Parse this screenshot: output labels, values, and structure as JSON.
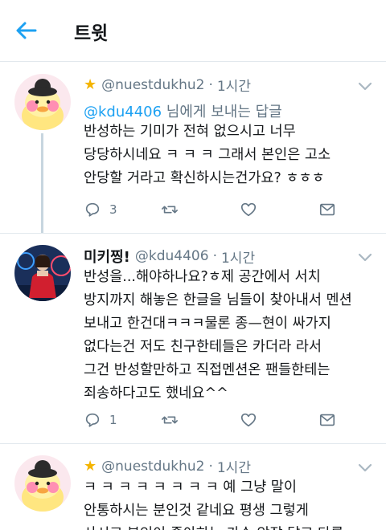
{
  "header": {
    "title": "트윗"
  },
  "tweets": [
    {
      "star": "★",
      "display_name": "",
      "handle": "@nuestdukhu2",
      "sep": "·",
      "time": "1시간",
      "reply_mention": "@kdu4406",
      "reply_suffix": " 님에게 보내는 답글",
      "lines": [
        "반성하는 기미가 전혀 없으시고 너무",
        "당당하시네요 ㅋ ㅋ ㅋ 그래서 본인은 고소",
        "안당할 거라고 확신하시는건가요? ㅎㅎㅎ"
      ],
      "reply_count": "3",
      "retweet_count": "",
      "like_count": ""
    },
    {
      "star": "",
      "display_name": "미키찡!",
      "handle": "@kdu4406",
      "sep": "·",
      "time": "1시간",
      "lines": [
        "반성을...해야하나요?ㅎ제 공간에서 서치",
        "방지까지 해놓은 한글을 님들이 찾아내서 멘션",
        "보내고 한건대ㅋㅋㅋ물론 종—현이 싸가지",
        "없다는건 저도 친구한테들은 카더라 라서",
        "그건 반성할만하고 직접멘션온 팬들한테는",
        "죄송하다고도 했네요^^"
      ],
      "reply_count": "1",
      "retweet_count": "",
      "like_count": ""
    },
    {
      "star": "★",
      "display_name": "",
      "handle": "@nuestdukhu2",
      "sep": "·",
      "time": "1시간",
      "lines": [
        "ㅋ ㅋ ㅋ ㅋ ㅋ ㅋ ㅋ ㅋ 예 그냥 말이",
        "안통하시는 분인것 같네요 평생 그렇게",
        "사시고 본인이 좋아하는 가수 앞잡 달고 다른"
      ]
    }
  ],
  "colors": {
    "accent": "#1da1f2",
    "muted": "#657786",
    "divider": "#e1e8ed",
    "star": "#f4b400"
  }
}
